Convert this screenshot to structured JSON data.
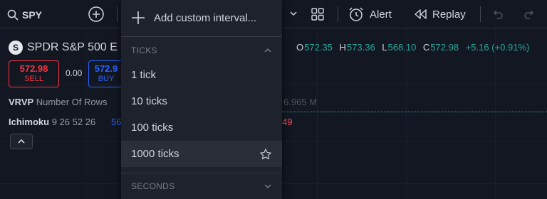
{
  "toolbar": {
    "symbol": "SPY",
    "alert_label": "Alert",
    "replay_label": "Replay"
  },
  "legend": {
    "logo_letter": "S",
    "title": "SPDR S&P 500 E",
    "ohlc": {
      "o_label": "O",
      "o_value": "572.35",
      "h_label": "H",
      "h_value": "573.36",
      "l_label": "L",
      "l_value": "568.10",
      "c_label": "C",
      "c_value": "572.98",
      "change": "+5.16 (+0.91%)"
    },
    "sell": {
      "price": "572.98",
      "label": "SELL"
    },
    "spread": "0.00",
    "buy": {
      "price": "572.9",
      "label": "BUY"
    }
  },
  "indicators": {
    "vrvp": {
      "name": "VRVP",
      "params": "Number Of Rows",
      "faded_value": "6.965 M"
    },
    "ichimoku": {
      "name": "Ichimoku",
      "params": "9 26 52 26",
      "value_blue": "56",
      "value_red": "49"
    }
  },
  "dropdown": {
    "add_custom_label": "Add custom interval...",
    "ticks_section": {
      "label": "TICKS",
      "items": [
        {
          "label": "1 tick"
        },
        {
          "label": "10 ticks"
        },
        {
          "label": "100 ticks"
        },
        {
          "label": "1000 ticks"
        }
      ]
    },
    "seconds_section": {
      "label": "SECONDS"
    }
  },
  "colors": {
    "background": "#131722",
    "panel": "#1e222d",
    "text": "#d1d4dc",
    "muted": "#787b86",
    "up": "#26a69a",
    "down": "#f23645",
    "accent": "#2962ff"
  }
}
